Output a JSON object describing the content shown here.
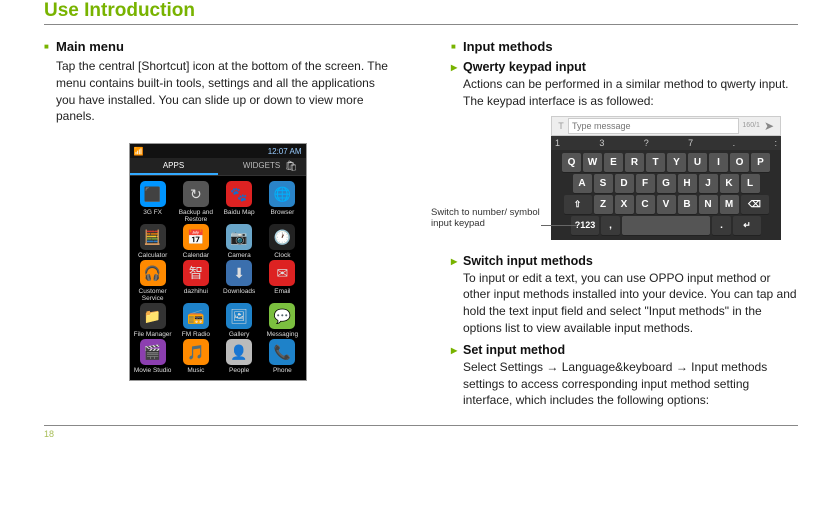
{
  "title": "Use Introduction",
  "page_number": "18",
  "left": {
    "h_main": "Main menu",
    "body_main": "Tap the central [Shortcut] icon at the bottom of the screen. The menu contains built-in tools, settings and all the applications you have installed. You can slide up or down to view more panels.",
    "status_time": "12:07 AM",
    "tab_apps": "APPS",
    "tab_widgets": "WIDGETS",
    "apps": [
      {
        "label": "3G FX",
        "bg": "#0095ff",
        "glyph": "⬛"
      },
      {
        "label": "Backup and Restore",
        "bg": "#555555",
        "glyph": "↻"
      },
      {
        "label": "Baidu Map",
        "bg": "#d22",
        "glyph": "🐾"
      },
      {
        "label": "Browser",
        "bg": "#2a84c8",
        "glyph": "🌐"
      },
      {
        "label": "Calculator",
        "bg": "#333",
        "glyph": "🧮"
      },
      {
        "label": "Calendar",
        "bg": "#ff8a00",
        "glyph": "📅"
      },
      {
        "label": "Camera",
        "bg": "#6aa6c9",
        "glyph": "📷"
      },
      {
        "label": "Clock",
        "bg": "#222",
        "glyph": "🕐"
      },
      {
        "label": "Customer Service",
        "bg": "#ff8a00",
        "glyph": "🎧"
      },
      {
        "label": "dazhihui",
        "bg": "#d22",
        "glyph": "智"
      },
      {
        "label": "Downloads",
        "bg": "#3b6fad",
        "glyph": "⬇"
      },
      {
        "label": "Email",
        "bg": "#d22",
        "glyph": "✉"
      },
      {
        "label": "File Manager",
        "bg": "#333",
        "glyph": "📁"
      },
      {
        "label": "FM Radio",
        "bg": "#1e82c9",
        "glyph": "📻"
      },
      {
        "label": "Gallery",
        "bg": "#1e82c9",
        "glyph": "🖼"
      },
      {
        "label": "Messaging",
        "bg": "#7bbf3f",
        "glyph": "💬"
      },
      {
        "label": "Movie Studio",
        "bg": "#8c3fb0",
        "glyph": "🎬"
      },
      {
        "label": "Music",
        "bg": "#ff8a00",
        "glyph": "🎵"
      },
      {
        "label": "People",
        "bg": "#bbbbbb",
        "glyph": "👤"
      },
      {
        "label": "Phone",
        "bg": "#1e82c9",
        "glyph": "📞"
      }
    ]
  },
  "right": {
    "h_input": "Input methods",
    "h_qwerty": "Qwerty keypad input",
    "body_qwerty": "Actions can be performed in a similar method to qwerty input. The keypad interface is as followed:",
    "msg_count": "160/1",
    "msg_placeholder": "Type message",
    "callout": "Switch to number/ symbol input keypad",
    "toprow": [
      "1",
      "3",
      "?",
      "7",
      ".",
      ":"
    ],
    "kb_r1": [
      "Q",
      "W",
      "E",
      "R",
      "T",
      "Y",
      "U",
      "I",
      "O",
      "P"
    ],
    "kb_r2": [
      "A",
      "S",
      "D",
      "F",
      "G",
      "H",
      "J",
      "K",
      "L"
    ],
    "kb_r3_shift": "⇧",
    "kb_r3": [
      "Z",
      "X",
      "C",
      "V",
      "B",
      "N",
      "M"
    ],
    "kb_r3_del": "⌫",
    "kb_r4_sym": "?123",
    "kb_r4_comma": ",",
    "kb_r4_dot": ".",
    "kb_r4_enter": "↵",
    "h_switch": "Switch input methods",
    "body_switch": "To input or edit a text, you can use OPPO input method or other input methods installed into your device. You can tap and hold the text input field and select \"Input methods\" in the options list to view available input methods.",
    "h_set": "Set input method",
    "set_pre": "Select Settings ",
    "set_mid": " Language&keyboard ",
    "set_post": " Input methods settings to access corresponding input method setting interface, which includes the following options:"
  }
}
